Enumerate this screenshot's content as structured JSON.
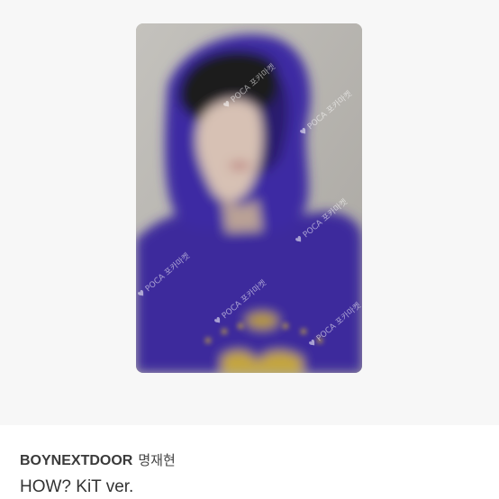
{
  "photocard": {
    "watermark_icon": "heart-icon",
    "watermark_text": "POCA 포카마켓"
  },
  "caption": {
    "group": "BOYNEXTDOOR",
    "member": "명재현",
    "version": "HOW? KiT ver."
  }
}
